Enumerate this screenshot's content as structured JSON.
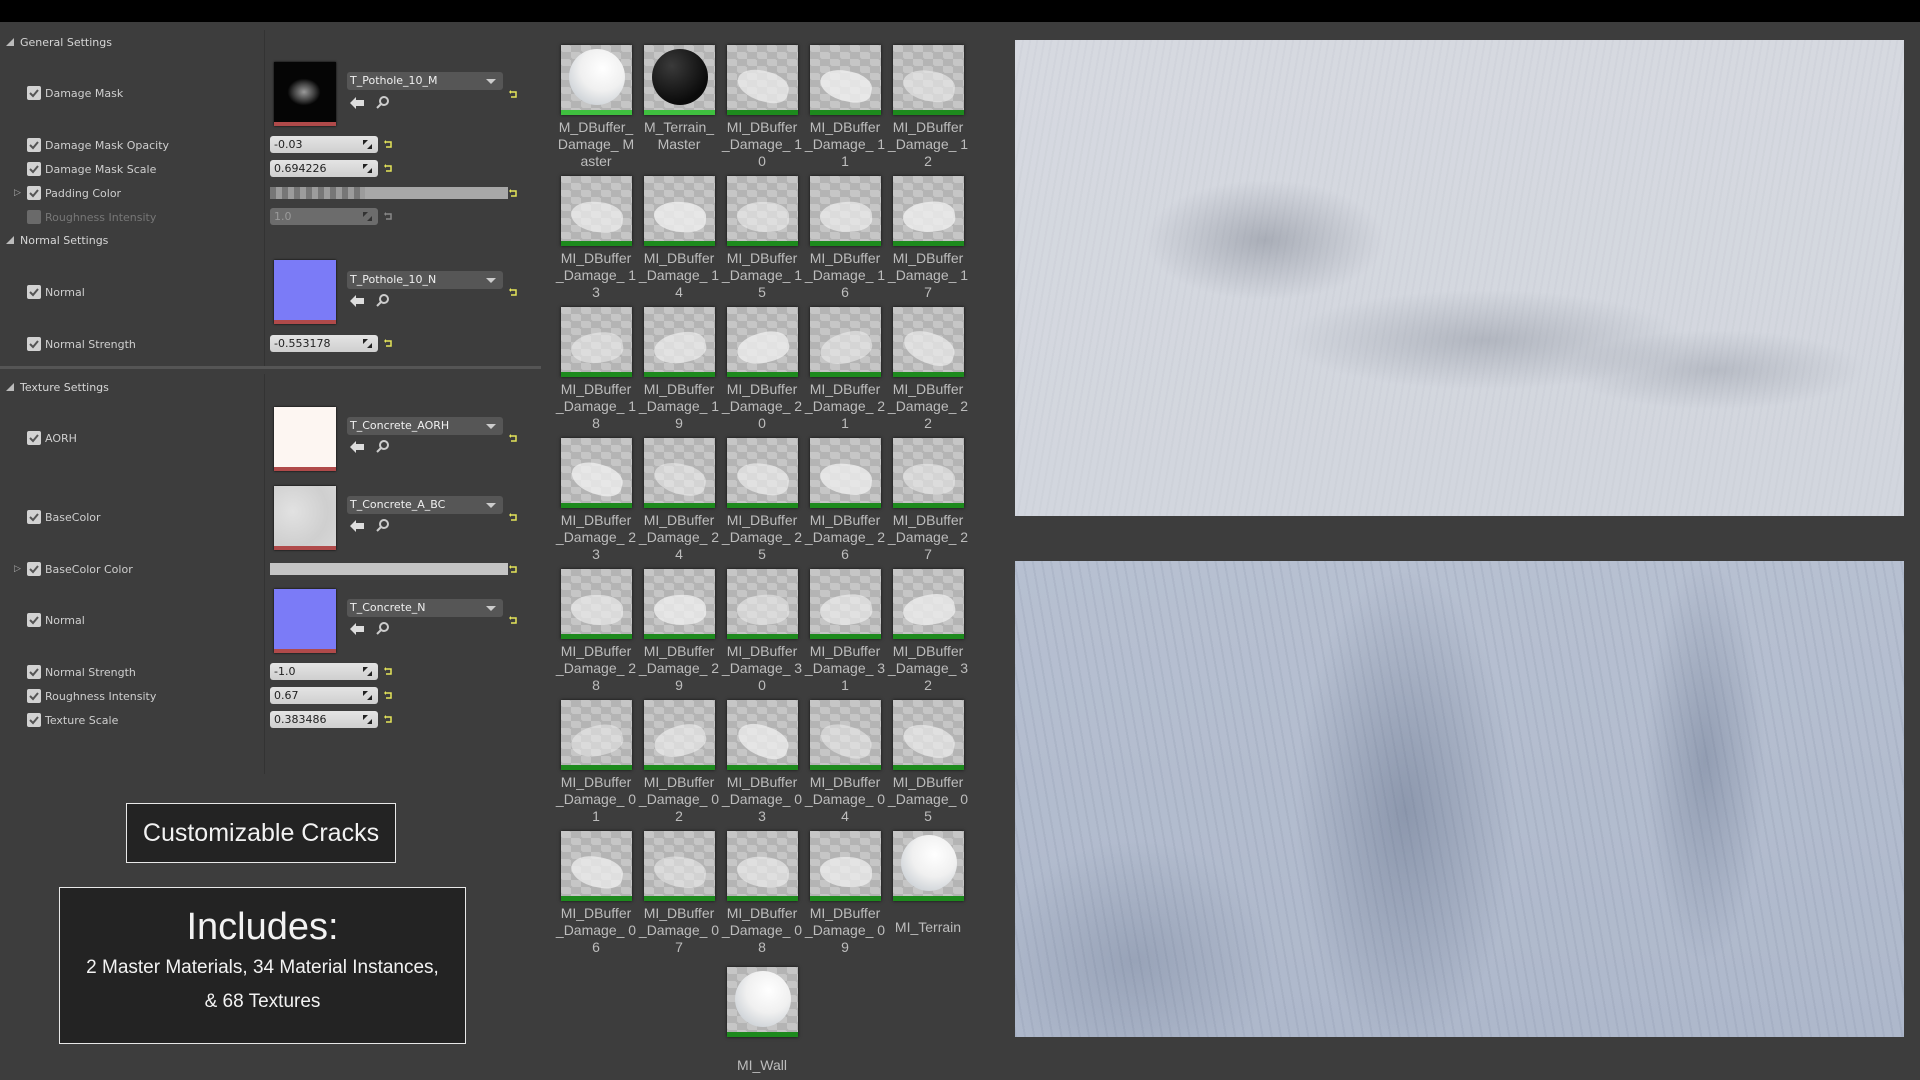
{
  "details": {
    "sections": {
      "general": "General Settings",
      "normal": "Normal Settings",
      "texture": "Texture Settings"
    },
    "general": {
      "damage_mask": {
        "label": "Damage Mask",
        "checked": true,
        "asset": "T_Pothole_10_M"
      },
      "damage_mask_opacity": {
        "label": "Damage Mask Opacity",
        "checked": true,
        "value": "-0.03"
      },
      "damage_mask_scale": {
        "label": "Damage Mask Scale",
        "checked": true,
        "value": "0.694226"
      },
      "padding_color": {
        "label": "Padding Color",
        "checked": true
      },
      "roughness_intensity": {
        "label": "Roughness Intensity",
        "checked": false,
        "value": "1.0"
      }
    },
    "normal": {
      "normal": {
        "label": "Normal",
        "checked": true,
        "asset": "T_Pothole_10_N"
      },
      "normal_strength": {
        "label": "Normal Strength",
        "checked": true,
        "value": "-0.553178"
      }
    },
    "texture": {
      "aorh": {
        "label": "AORH",
        "checked": true,
        "asset": "T_Concrete_AORH"
      },
      "basecolor": {
        "label": "BaseColor",
        "checked": true,
        "asset": "T_Concrete_A_BC"
      },
      "basecolor_color": {
        "label": "BaseColor Color",
        "checked": true
      },
      "normal": {
        "label": "Normal",
        "checked": true,
        "asset": "T_Concrete_N"
      },
      "normal_strength": {
        "label": "Normal Strength",
        "checked": true,
        "value": "-1.0"
      },
      "roughness_intensity": {
        "label": "Roughness Intensity",
        "checked": true,
        "value": "0.67"
      },
      "texture_scale": {
        "label": "Texture Scale",
        "checked": true,
        "value": "0.383486"
      }
    }
  },
  "promo": {
    "feature": "Customizable Cracks",
    "includes_title": "Includes:",
    "includes_line1": "2 Master Materials, 34 Material Instances,",
    "includes_line2": "& 68 Textures"
  },
  "assets": [
    {
      "name": "M_DBuffer_ Damage_ Master",
      "kind": "master-white"
    },
    {
      "name": "M_Terrain_ Master",
      "kind": "master-black"
    },
    {
      "name": "MI_DBuffer _Damage_ 10",
      "kind": "decal"
    },
    {
      "name": "MI_DBuffer _Damage_ 11",
      "kind": "decal"
    },
    {
      "name": "MI_DBuffer _Damage_ 12",
      "kind": "decal"
    },
    {
      "name": "MI_DBuffer _Damage_ 13",
      "kind": "decal"
    },
    {
      "name": "MI_DBuffer _Damage_ 14",
      "kind": "decal"
    },
    {
      "name": "MI_DBuffer _Damage_ 15",
      "kind": "decal"
    },
    {
      "name": "MI_DBuffer _Damage_ 16",
      "kind": "decal"
    },
    {
      "name": "MI_DBuffer _Damage_ 17",
      "kind": "decal"
    },
    {
      "name": "MI_DBuffer _Damage_ 18",
      "kind": "decal"
    },
    {
      "name": "MI_DBuffer _Damage_ 19",
      "kind": "decal"
    },
    {
      "name": "MI_DBuffer _Damage_ 20",
      "kind": "decal"
    },
    {
      "name": "MI_DBuffer _Damage_ 21",
      "kind": "decal"
    },
    {
      "name": "MI_DBuffer _Damage_ 22",
      "kind": "decal"
    },
    {
      "name": "MI_DBuffer _Damage_ 23",
      "kind": "decal"
    },
    {
      "name": "MI_DBuffer _Damage_ 24",
      "kind": "decal"
    },
    {
      "name": "MI_DBuffer _Damage_ 25",
      "kind": "decal"
    },
    {
      "name": "MI_DBuffer _Damage_ 26",
      "kind": "decal"
    },
    {
      "name": "MI_DBuffer _Damage_ 27",
      "kind": "decal"
    },
    {
      "name": "MI_DBuffer _Damage_ 28",
      "kind": "decal"
    },
    {
      "name": "MI_DBuffer _Damage_ 29",
      "kind": "decal"
    },
    {
      "name": "MI_DBuffer _Damage_ 30",
      "kind": "decal"
    },
    {
      "name": "MI_DBuffer _Damage_ 31",
      "kind": "decal"
    },
    {
      "name": "MI_DBuffer _Damage_ 32",
      "kind": "decal"
    },
    {
      "name": "MI_DBuffer _Damage_ 01",
      "kind": "decal"
    },
    {
      "name": "MI_DBuffer _Damage_ 02",
      "kind": "decal"
    },
    {
      "name": "MI_DBuffer _Damage_ 03",
      "kind": "decal"
    },
    {
      "name": "MI_DBuffer _Damage_ 04",
      "kind": "decal"
    },
    {
      "name": "MI_DBuffer _Damage_ 05",
      "kind": "decal"
    },
    {
      "name": "MI_DBuffer _Damage_ 06",
      "kind": "decal"
    },
    {
      "name": "MI_DBuffer _Damage_ 07",
      "kind": "decal"
    },
    {
      "name": "MI_DBuffer _Damage_ 08",
      "kind": "decal"
    },
    {
      "name": "MI_DBuffer _Damage_ 09",
      "kind": "decal"
    },
    {
      "name": "MI_Terrain",
      "kind": "sphere-white"
    },
    {
      "name": "MI_Wall",
      "kind": "sphere-white"
    }
  ],
  "colors": {
    "texture_bar": "#b04a4a",
    "material_bar": "#1d8a1d",
    "master_bar": "#3fbf3f",
    "normal_map": "#7b7bf7",
    "reset_arrow": "#e5e55a"
  }
}
